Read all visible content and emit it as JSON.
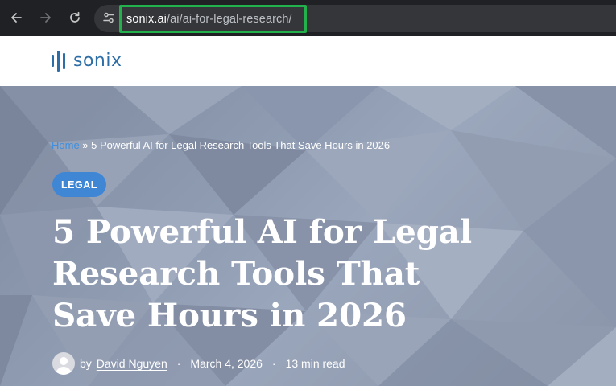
{
  "browser": {
    "url_domain": "sonix.ai",
    "url_path": "/ai/ai-for-legal-research/",
    "icons": {
      "back": "arrow-left-icon",
      "forward": "arrow-right-icon",
      "reload": "reload-icon",
      "site_info": "tune-icon"
    }
  },
  "site": {
    "logo_text": "sonix",
    "brand_color": "#2e6ea6"
  },
  "article": {
    "breadcrumb": {
      "home": "Home",
      "separator": " » ",
      "current": "5 Powerful AI for Legal Research Tools That Save Hours in 2026"
    },
    "category": "LEGAL",
    "title": "5 Powerful AI for Legal Research Tools That Save Hours in 2026",
    "byline": {
      "by": "by",
      "author": "David Nguyen",
      "date": "March 4, 2026",
      "read_time": "13 min read",
      "separator": "·"
    }
  },
  "colors": {
    "tag": "#3f86d4",
    "link": "#3d8fe0",
    "highlight_box": "#22b14c"
  }
}
